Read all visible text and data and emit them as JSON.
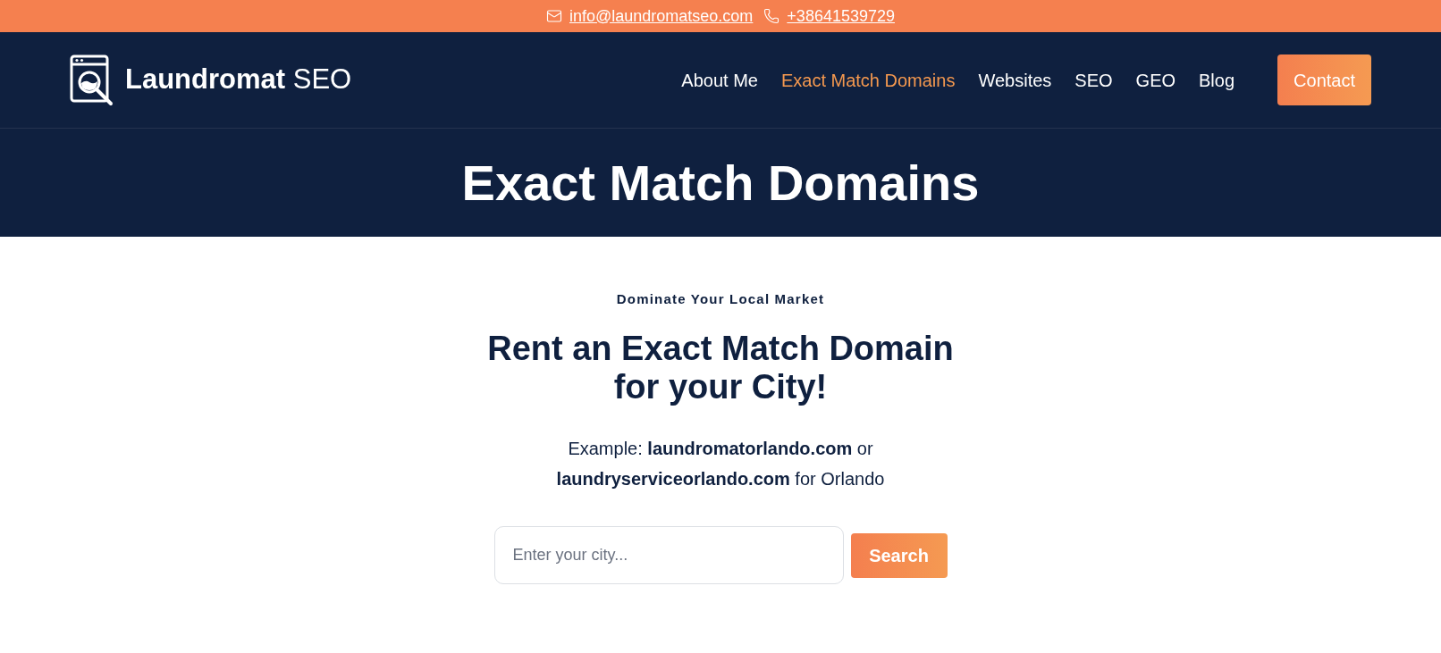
{
  "top_bar": {
    "email": "info@laundromatseo.com",
    "phone": "+38641539729"
  },
  "header": {
    "logo": {
      "bold": "Laundromat",
      "light": "SEO"
    },
    "nav": [
      {
        "label": "About Me",
        "selected": false
      },
      {
        "label": "Exact Match Domains",
        "selected": true
      },
      {
        "label": "Websites",
        "selected": false
      },
      {
        "label": "SEO",
        "selected": false
      },
      {
        "label": "GEO",
        "selected": false
      },
      {
        "label": "Blog",
        "selected": false
      }
    ],
    "cta": "Contact"
  },
  "hero": {
    "title": "Exact Match Domains"
  },
  "section": {
    "eyebrow": "Dominate Your Local Market",
    "heading": "Rent an Exact Match Domain for your City!",
    "example": "Example: **laundromatorlando.com** or **laundryserviceorlando.com** for Orlando",
    "search": {
      "placeholder": "Enter your city...",
      "button": "Search"
    }
  }
}
